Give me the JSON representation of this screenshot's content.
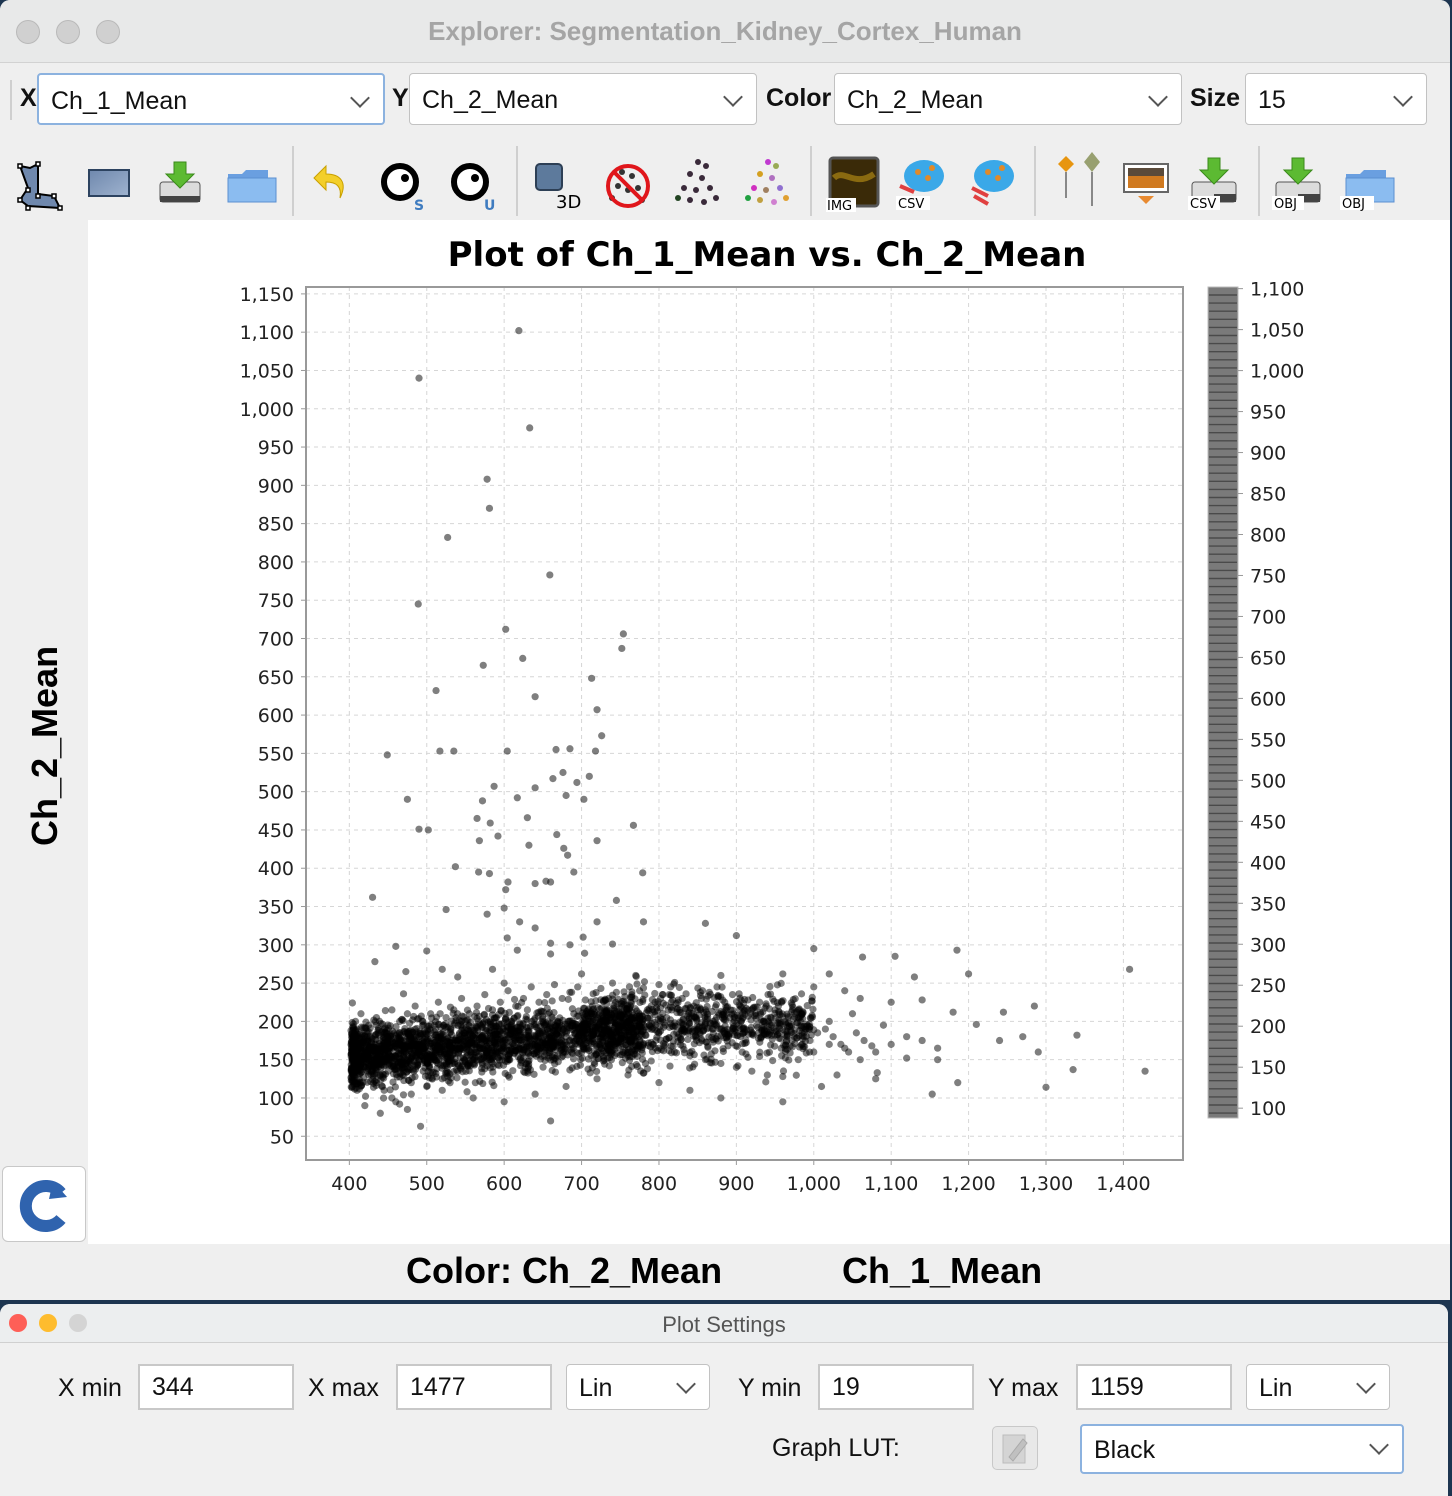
{
  "window": {
    "title": "Explorer: Segmentation_Kidney_Cortex_Human"
  },
  "selectors": {
    "x_label": "X",
    "x_value": "Ch_1_Mean",
    "y_label": "Y",
    "y_value": "Ch_2_Mean",
    "color_label": "Color",
    "color_value": "Ch_2_Mean",
    "size_label": "Size",
    "size_value": "15"
  },
  "toolbar": {
    "items": [
      {
        "icon": "polygon-roi-icon"
      },
      {
        "icon": "rectangle-roi-icon"
      },
      {
        "icon": "save-roi-icon"
      },
      {
        "icon": "open-roi-icon"
      },
      {
        "icon": "undo-icon"
      },
      {
        "icon": "gate-select-icon",
        "sub": "S"
      },
      {
        "icon": "gate-unselect-icon",
        "sub": "U"
      },
      {
        "icon": "3d-view-icon",
        "sub": "3D"
      },
      {
        "icon": "clear-cells-icon"
      },
      {
        "icon": "cells-dark-icon"
      },
      {
        "icon": "cells-color-icon"
      },
      {
        "icon": "image-overlay-icon",
        "sub": "IMG"
      },
      {
        "icon": "export-csv-cells-icon",
        "sub": "CSV"
      },
      {
        "icon": "cells-cluster-icon"
      },
      {
        "icon": "pins-icon"
      },
      {
        "icon": "snapshot-icon"
      },
      {
        "icon": "save-csv-icon",
        "sub": "CSV"
      },
      {
        "icon": "save-obj-icon",
        "sub": "OBJ"
      },
      {
        "icon": "open-obj-icon",
        "sub": "OBJ"
      }
    ]
  },
  "axis_labels": {
    "y": "Ch_2_Mean",
    "x": "Ch_1_Mean",
    "color": "Color: Ch_2_Mean"
  },
  "chart_data": {
    "type": "scatter",
    "title": "Plot of Ch_1_Mean vs. Ch_2_Mean",
    "xlabel": "Ch_1_Mean",
    "ylabel": "Ch_2_Mean",
    "xlim": [
      344,
      1477
    ],
    "ylim": [
      19,
      1159
    ],
    "x_ticks": [
      "400",
      "500",
      "600",
      "700",
      "800",
      "900",
      "1,000",
      "1,100",
      "1,200",
      "1,300",
      "1,400"
    ],
    "x_tick_values": [
      400,
      500,
      600,
      700,
      800,
      900,
      1000,
      1100,
      1200,
      1300,
      1400
    ],
    "y_ticks": [
      "50",
      "100",
      "150",
      "200",
      "250",
      "300",
      "350",
      "400",
      "450",
      "500",
      "550",
      "600",
      "650",
      "700",
      "750",
      "800",
      "850",
      "900",
      "950",
      "1,000",
      "1,050",
      "1,100",
      "1,150"
    ],
    "y_tick_values": [
      50,
      100,
      150,
      200,
      250,
      300,
      350,
      400,
      450,
      500,
      550,
      600,
      650,
      700,
      750,
      800,
      850,
      900,
      950,
      1000,
      1050,
      1100,
      1150
    ],
    "grid": true,
    "point_color": "#000000",
    "point_opacity": 0.5,
    "colorbar": {
      "label": "Ch_2_Mean",
      "range": [
        88,
        1102
      ],
      "ticks": [
        "1,100",
        "1,050",
        "1,000",
        "950",
        "900",
        "850",
        "800",
        "750",
        "700",
        "650",
        "600",
        "550",
        "500",
        "450",
        "400",
        "350",
        "300",
        "250",
        "200",
        "150",
        "100"
      ],
      "tick_values": [
        1100,
        1050,
        1000,
        950,
        900,
        850,
        800,
        750,
        700,
        650,
        600,
        550,
        500,
        450,
        400,
        350,
        300,
        250,
        200,
        150,
        100
      ],
      "lut": "Black",
      "color": "#7a7a7a"
    },
    "points": [
      [
        619,
        1102
      ],
      [
        490,
        1040
      ],
      [
        633,
        975
      ],
      [
        578,
        908
      ],
      [
        581,
        870
      ],
      [
        527,
        832
      ],
      [
        659,
        783
      ],
      [
        489,
        745
      ],
      [
        602,
        712
      ],
      [
        754,
        706
      ],
      [
        624,
        674
      ],
      [
        752,
        687
      ],
      [
        573,
        665
      ],
      [
        713,
        648
      ],
      [
        640,
        624
      ],
      [
        512,
        632
      ],
      [
        720,
        607
      ],
      [
        726,
        573
      ],
      [
        604,
        553
      ],
      [
        685,
        556
      ],
      [
        449,
        548
      ],
      [
        517,
        553
      ],
      [
        535,
        553
      ],
      [
        667,
        555
      ],
      [
        718,
        553
      ],
      [
        663,
        517
      ],
      [
        587,
        507
      ],
      [
        676,
        525
      ],
      [
        710,
        520
      ],
      [
        694,
        512
      ],
      [
        475,
        490
      ],
      [
        640,
        505
      ],
      [
        680,
        495
      ],
      [
        617,
        492
      ],
      [
        572,
        488
      ],
      [
        630,
        466
      ],
      [
        703,
        490
      ],
      [
        565,
        465
      ],
      [
        582,
        459
      ],
      [
        767,
        456
      ],
      [
        490,
        451
      ],
      [
        502,
        450
      ],
      [
        592,
        442
      ],
      [
        668,
        444
      ],
      [
        677,
        426
      ],
      [
        632,
        430
      ],
      [
        568,
        436
      ],
      [
        720,
        436
      ],
      [
        682,
        417
      ],
      [
        537,
        402
      ],
      [
        654,
        383
      ],
      [
        640,
        380
      ],
      [
        690,
        395
      ],
      [
        581,
        393
      ],
      [
        567,
        395
      ],
      [
        602,
        372
      ],
      [
        660,
        382
      ],
      [
        605,
        382
      ],
      [
        779,
        394
      ],
      [
        745,
        358
      ],
      [
        430,
        362
      ],
      [
        600,
        348
      ],
      [
        525,
        346
      ],
      [
        578,
        340
      ],
      [
        620,
        330
      ],
      [
        640,
        322
      ],
      [
        720,
        330
      ],
      [
        780,
        330
      ],
      [
        702,
        310
      ],
      [
        685,
        300
      ],
      [
        604,
        309
      ],
      [
        860,
        328
      ],
      [
        660,
        302
      ],
      [
        900,
        312
      ],
      [
        740,
        301
      ],
      [
        617,
        293
      ],
      [
        660,
        288
      ],
      [
        704,
        289
      ],
      [
        500,
        292
      ],
      [
        460,
        298
      ],
      [
        1000,
        295
      ],
      [
        1185,
        293
      ],
      [
        1063,
        284
      ],
      [
        1105,
        285
      ],
      [
        1200,
        262
      ],
      [
        1408,
        268
      ],
      [
        1285,
        220
      ],
      [
        1340,
        182
      ],
      [
        1245,
        212
      ],
      [
        1020,
        262
      ],
      [
        1130,
        258
      ],
      [
        1290,
        160
      ],
      [
        1428,
        135
      ],
      [
        1300,
        114
      ],
      [
        1335,
        137
      ],
      [
        1186,
        120
      ],
      [
        1030,
        130
      ],
      [
        938,
        121
      ],
      [
        915,
        153
      ],
      [
        902,
        142
      ],
      [
        1160,
        150
      ],
      [
        1153,
        105
      ],
      [
        1120,
        152
      ],
      [
        1270,
        180
      ],
      [
        1240,
        175
      ],
      [
        1080,
        125
      ],
      [
        1082,
        133
      ],
      [
        660,
        70
      ],
      [
        492,
        63
      ],
      [
        433,
        278
      ],
      [
        473,
        265
      ],
      [
        520,
        268
      ],
      [
        585,
        268
      ],
      [
        540,
        258
      ],
      [
        600,
        250
      ],
      [
        470,
        236
      ],
      [
        700,
        262
      ],
      [
        740,
        250
      ],
      [
        770,
        260
      ],
      [
        800,
        248
      ],
      [
        880,
        260
      ],
      [
        960,
        262
      ],
      [
        1000,
        245
      ],
      [
        1040,
        240
      ],
      [
        1060,
        230
      ],
      [
        1100,
        225
      ],
      [
        1140,
        228
      ],
      [
        1180,
        212
      ],
      [
        1210,
        196
      ],
      [
        1090,
        195
      ],
      [
        1050,
        210
      ],
      [
        1020,
        200
      ],
      [
        980,
        205
      ],
      [
        950,
        215
      ],
      [
        930,
        225
      ],
      [
        910,
        190
      ],
      [
        890,
        180
      ],
      [
        870,
        200
      ],
      [
        850,
        215
      ],
      [
        830,
        230
      ],
      [
        810,
        205
      ],
      [
        790,
        220
      ],
      [
        770,
        180
      ],
      [
        750,
        205
      ],
      [
        730,
        215
      ],
      [
        710,
        200
      ],
      [
        690,
        210
      ],
      [
        670,
        190
      ],
      [
        650,
        200
      ],
      [
        630,
        215
      ],
      [
        610,
        190
      ],
      [
        590,
        205
      ],
      [
        570,
        195
      ],
      [
        550,
        200
      ],
      [
        530,
        185
      ],
      [
        510,
        195
      ],
      [
        490,
        180
      ],
      [
        470,
        175
      ],
      [
        450,
        170
      ],
      [
        430,
        165
      ],
      [
        410,
        160
      ],
      [
        405,
        150
      ],
      [
        415,
        140
      ],
      [
        425,
        130
      ],
      [
        435,
        120
      ],
      [
        445,
        110
      ],
      [
        455,
        100
      ],
      [
        465,
        92
      ],
      [
        475,
        85
      ],
      [
        420,
        90
      ],
      [
        440,
        80
      ],
      [
        460,
        95
      ],
      [
        480,
        105
      ],
      [
        500,
        115
      ],
      [
        520,
        125
      ],
      [
        540,
        135
      ],
      [
        560,
        145
      ],
      [
        580,
        150
      ],
      [
        600,
        160
      ],
      [
        620,
        165
      ],
      [
        640,
        170
      ],
      [
        660,
        175
      ],
      [
        680,
        180
      ],
      [
        700,
        185
      ],
      [
        720,
        190
      ],
      [
        740,
        180
      ],
      [
        760,
        175
      ],
      [
        780,
        170
      ],
      [
        800,
        165
      ],
      [
        820,
        160
      ],
      [
        840,
        155
      ],
      [
        860,
        150
      ],
      [
        880,
        145
      ],
      [
        900,
        140
      ],
      [
        920,
        135
      ],
      [
        940,
        130
      ],
      [
        960,
        128
      ],
      [
        980,
        150
      ],
      [
        1000,
        160
      ],
      [
        1020,
        170
      ],
      [
        1040,
        165
      ],
      [
        1060,
        150
      ],
      [
        1080,
        160
      ],
      [
        1100,
        170
      ],
      [
        1120,
        180
      ],
      [
        1140,
        175
      ],
      [
        1160,
        165
      ],
      [
        1010,
        115
      ],
      [
        960,
        95
      ],
      [
        880,
        100
      ],
      [
        840,
        110
      ],
      [
        800,
        120
      ],
      [
        760,
        130
      ],
      [
        720,
        125
      ],
      [
        680,
        115
      ],
      [
        640,
        105
      ],
      [
        600,
        95
      ],
      [
        560,
        100
      ],
      [
        520,
        110
      ],
      [
        480,
        120
      ],
      [
        440,
        130
      ],
      [
        410,
        110
      ],
      [
        405,
        180
      ],
      [
        408,
        200
      ],
      [
        415,
        210
      ],
      [
        425,
        195
      ],
      [
        435,
        205
      ],
      [
        445,
        190
      ],
      [
        455,
        215
      ],
      [
        465,
        200
      ],
      [
        475,
        210
      ],
      [
        485,
        220
      ],
      [
        495,
        200
      ],
      [
        505,
        210
      ],
      [
        515,
        225
      ],
      [
        525,
        205
      ],
      [
        535,
        215
      ],
      [
        545,
        230
      ],
      [
        555,
        210
      ],
      [
        565,
        220
      ],
      [
        575,
        235
      ],
      [
        585,
        215
      ],
      [
        595,
        225
      ],
      [
        605,
        240
      ],
      [
        615,
        220
      ],
      [
        625,
        230
      ],
      [
        635,
        245
      ],
      [
        645,
        225
      ],
      [
        655,
        235
      ],
      [
        665,
        248
      ],
      [
        675,
        230
      ],
      [
        685,
        238
      ],
      [
        695,
        245
      ],
      [
        705,
        228
      ],
      [
        715,
        236
      ],
      [
        725,
        243
      ],
      [
        735,
        230
      ],
      [
        745,
        238
      ],
      [
        755,
        222
      ],
      [
        765,
        232
      ],
      [
        775,
        240
      ],
      [
        785,
        215
      ],
      [
        795,
        225
      ],
      [
        805,
        235
      ],
      [
        815,
        245
      ],
      [
        825,
        228
      ],
      [
        835,
        236
      ],
      [
        845,
        220
      ],
      [
        855,
        230
      ],
      [
        865,
        238
      ],
      [
        875,
        245
      ],
      [
        885,
        225
      ],
      [
        895,
        235
      ],
      [
        905,
        220
      ],
      [
        915,
        228
      ],
      [
        925,
        210
      ],
      [
        935,
        200
      ],
      [
        945,
        195
      ],
      [
        955,
        185
      ],
      [
        965,
        175
      ],
      [
        975,
        180
      ],
      [
        985,
        170
      ],
      [
        995,
        175
      ],
      [
        1005,
        185
      ],
      [
        1015,
        190
      ],
      [
        1025,
        180
      ],
      [
        1035,
        170
      ],
      [
        1045,
        160
      ],
      [
        1055,
        185
      ],
      [
        1065,
        175
      ],
      [
        1075,
        168
      ]
    ],
    "dense_cluster": {
      "description": "Dense core cluster of several thousand points",
      "x_center": 540,
      "y_center": 155,
      "x_extent": [
        400,
        780
      ],
      "y_extent": [
        80,
        230
      ],
      "tail": {
        "x_extent": [
          700,
          1000
        ],
        "y_center": 195,
        "y_spread": 45
      },
      "count_estimate": 3000,
      "seed": 7
    }
  },
  "settings": {
    "title": "Plot Settings",
    "x_min_label": "X min",
    "x_min": "344",
    "x_max_label": "X max",
    "x_max": "1477",
    "x_scale": "Lin",
    "y_min_label": "Y min",
    "y_min": "19",
    "y_max_label": "Y max",
    "y_max": "1159",
    "y_scale": "Lin",
    "lut_label": "Graph LUT:",
    "lut_value": "Black"
  }
}
